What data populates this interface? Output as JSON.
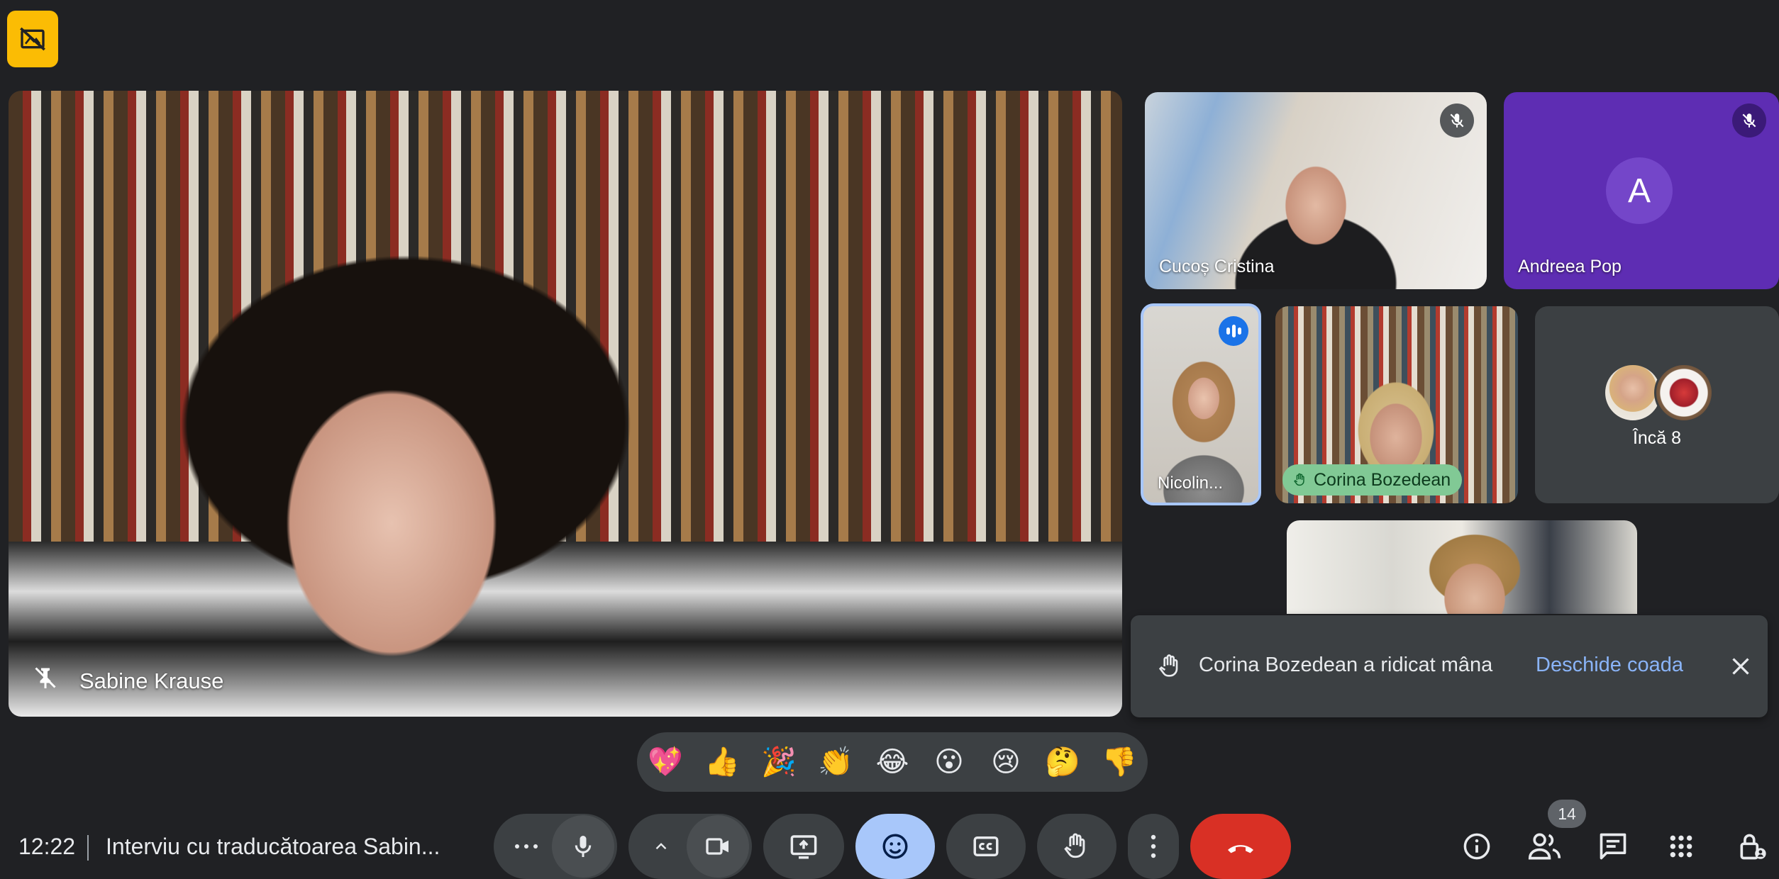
{
  "top_badge": {
    "icon": "no-background-icon",
    "color": "#fbbc04"
  },
  "main_speaker": {
    "name": "Sabine Krause",
    "pin_icon": "pin-off-icon"
  },
  "participants": [
    {
      "name": "Cucoș Cristina",
      "muted": true
    },
    {
      "name": "Andreea Pop",
      "initial": "A",
      "muted": true,
      "tile_color": "#5e2db3"
    },
    {
      "name": "Nicolin...",
      "speaking": true
    },
    {
      "name": "Corina Bozedean",
      "hand_raised": true
    },
    {
      "name": "Încă 8"
    }
  ],
  "notification": {
    "message": "Corina Bozedean a ridicat mâna",
    "action": "Deschide coada",
    "close_icon": "close-icon"
  },
  "reactions": [
    "💖",
    "👍",
    "🎉",
    "👏",
    "😂",
    "😮",
    "😢",
    "🤔",
    "👎"
  ],
  "bottom": {
    "time": "12:22",
    "meeting_title": "Interviu cu traducătoarea Sabin...",
    "people_count": "14"
  }
}
